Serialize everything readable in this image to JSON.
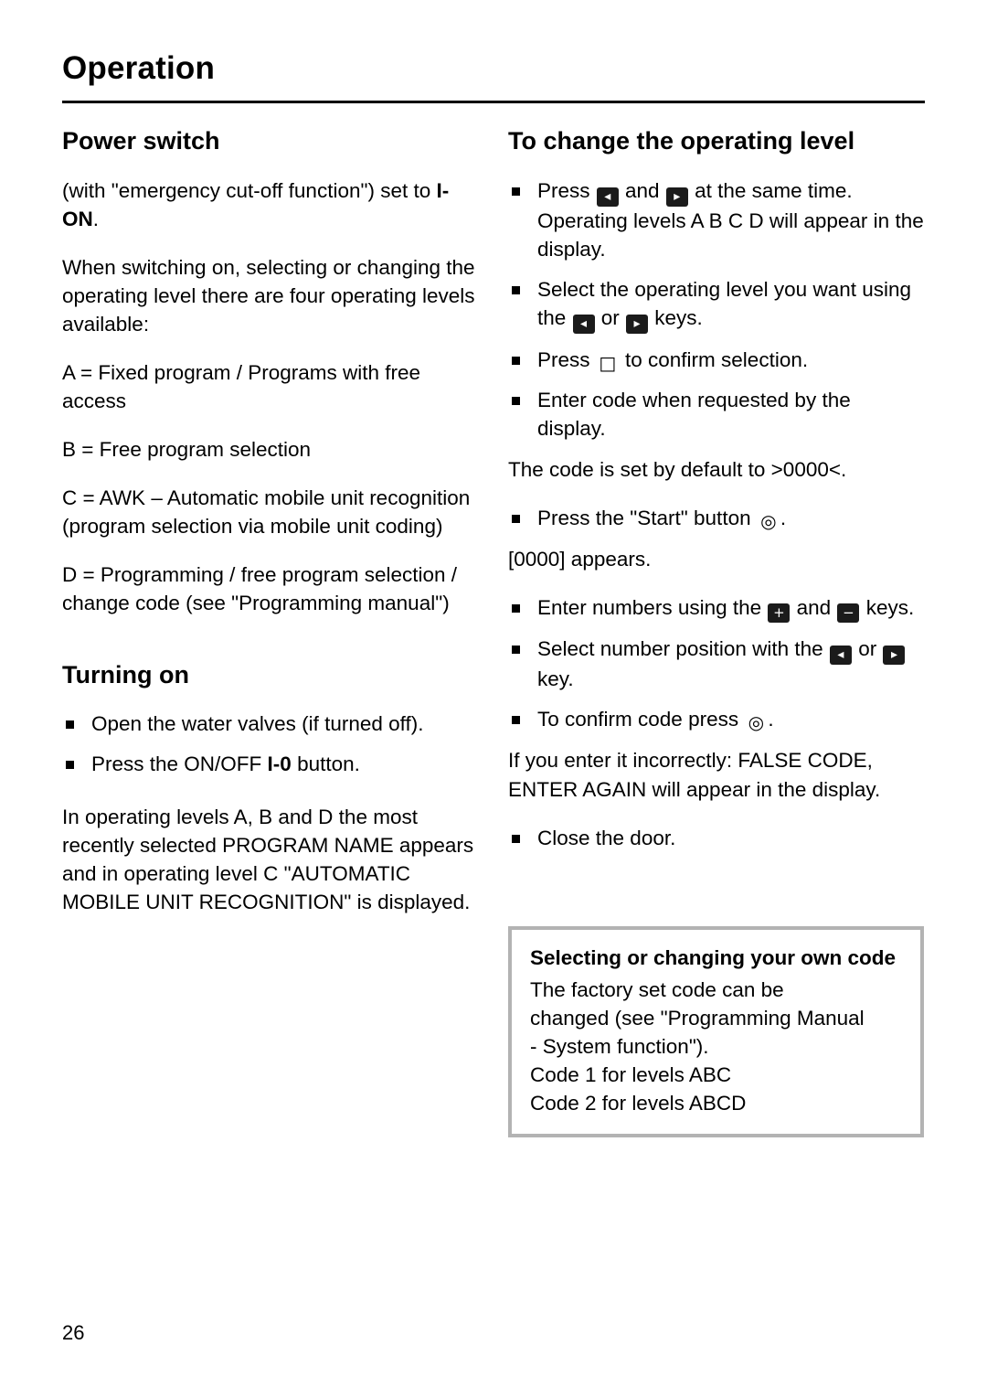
{
  "header": {
    "title": "Operation"
  },
  "left_column": {
    "section1_title": "Power switch",
    "p1_a": "(with \"emergency cut-off function\") set to ",
    "p1_b": "I-ON",
    "p1_c": ".",
    "p2": "When switching on, selecting or changing the operating level there are four operating levels available:",
    "p3": "A = Fixed program / Programs with free access",
    "p4": "B = Free program selection",
    "p5": "C = AWK – Automatic mobile unit recognition (program selection via mobile unit coding)",
    "p6": "D = Programming / free program selection / change code (see \"Programming manual\")",
    "section2_title": "Turning on",
    "bullet1": "Open the water valves (if turned off).",
    "bullet2_a": "Press the ON/OFF ",
    "bullet2_b": "I-0",
    "bullet2_c": " button.",
    "p7": "In operating levels A, B and D the most recently selected PROGRAM NAME appears and in operating level C \"AUTOMATIC MOBILE UNIT RECOGNITION\" is displayed."
  },
  "right_column": {
    "section_title": "To change the operating level",
    "b1_a": "Press ",
    "b1_key1": "◂",
    "b1_b": " and ",
    "b1_key2": "▸",
    "b1_c": " at the same time. Operating levels A B C D will appear in the display.",
    "b2_a": "Select the operating level you want using the ",
    "b2_key1": "◂",
    "b2_b": " or ",
    "b2_key2": "▸",
    "b2_c": " keys.",
    "b3_a": "Press ",
    "b3_key": "□",
    "b3_b": " to confirm selection.",
    "b4": "Enter code when requested by the display.",
    "p1": "The code is set by default to >0000<.",
    "b5_a": "Press the \"Start\" button ",
    "b5_key": "◎",
    "b5_b": ".",
    "p2": "[0000] appears.",
    "b6_a": "Enter numbers using the ",
    "b6_key1": "+",
    "b6_b": " and ",
    "b6_key2": "−",
    "b6_c": " keys.",
    "b7_a": "Select number position with the ",
    "b7_key1": "◂",
    "b7_b": " or ",
    "b7_key2": "▸",
    "b7_c": " key.",
    "b8_a": "To confirm code press ",
    "b8_key": "◎",
    "b8_b": ".",
    "p3": "If you enter it incorrectly: FALSE CODE, ENTER AGAIN will appear in the display.",
    "b9": "Close the door."
  },
  "note_box": {
    "title": "Selecting or changing your own code",
    "line1": "The factory set code can be",
    "line2": "changed (see \"Programming Manual",
    "line3": "- System function\").",
    "line4": "Code 1 for levels ABC",
    "line5": "Code 2 for levels ABCD"
  },
  "footer": {
    "page_number": "26"
  }
}
